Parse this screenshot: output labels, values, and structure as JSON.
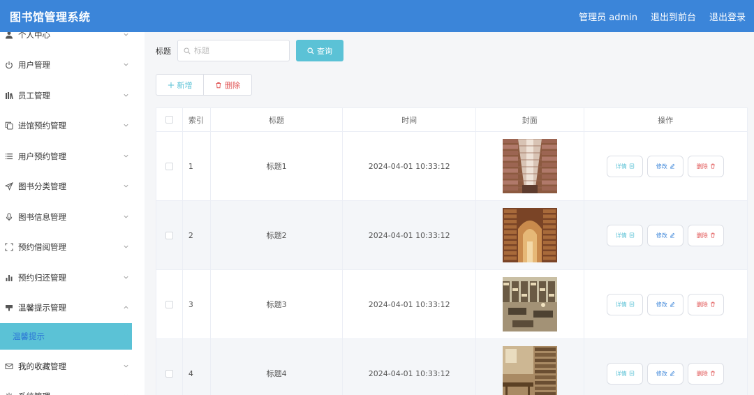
{
  "app": {
    "title": "图书馆管理系统"
  },
  "header": {
    "admin": "管理员 admin",
    "to_front": "退出到前台",
    "logout": "退出登录"
  },
  "sidebar": {
    "items": [
      {
        "label": "个人中心",
        "icon": "person-icon"
      },
      {
        "label": "用户管理",
        "icon": "power-icon"
      },
      {
        "label": "员工管理",
        "icon": "books-icon"
      },
      {
        "label": "进馆预约管理",
        "icon": "copy-icon"
      },
      {
        "label": "用户预约管理",
        "icon": "list-icon"
      },
      {
        "label": "图书分类管理",
        "icon": "send-icon"
      },
      {
        "label": "图书信息管理",
        "icon": "microphone-icon"
      },
      {
        "label": "预约借阅管理",
        "icon": "scan-icon"
      },
      {
        "label": "预约归还管理",
        "icon": "bar-chart-icon"
      },
      {
        "label": "温馨提示管理",
        "icon": "cup-icon",
        "expanded": true
      },
      {
        "label": "我的收藏管理",
        "icon": "mail-icon"
      },
      {
        "label": "系统管理",
        "icon": "gear-icon"
      }
    ],
    "active_sub": "温馨提示"
  },
  "search": {
    "label": "标题",
    "placeholder": "标题",
    "button": "查询"
  },
  "actions": {
    "add": "新增",
    "delete": "删除"
  },
  "table": {
    "columns": [
      "索引",
      "标题",
      "时间",
      "封面",
      "操作"
    ],
    "rows": [
      {
        "index": "1",
        "title": "标题1",
        "time": "2024-04-01 10:33:12",
        "cover": "library-hall"
      },
      {
        "index": "2",
        "title": "标题2",
        "time": "2024-04-01 10:33:12",
        "cover": "library-arch"
      },
      {
        "index": "3",
        "title": "标题3",
        "time": "2024-04-01 10:33:12",
        "cover": "library-reading"
      },
      {
        "index": "4",
        "title": "标题4",
        "time": "2024-04-01 10:33:12",
        "cover": "library-study"
      }
    ],
    "ops": {
      "detail": "详情",
      "edit": "修改",
      "delete": "删除"
    }
  },
  "colors": {
    "header": "#3b85d9",
    "accent": "#5bc2d6",
    "danger": "#e05252"
  }
}
